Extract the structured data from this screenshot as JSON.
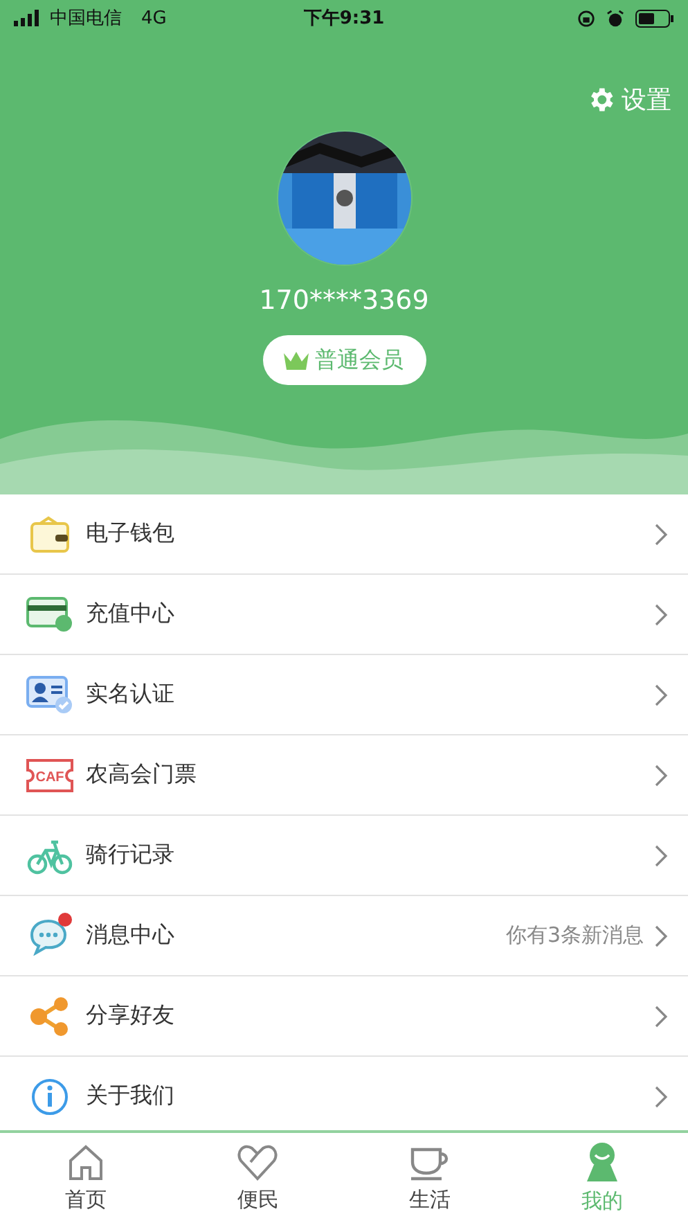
{
  "status_bar": {
    "carrier": "中国电信",
    "network": "4G",
    "time": "下午9:31"
  },
  "header": {
    "settings_label": "设置",
    "phone": "170****3369",
    "member_badge": "普通会员"
  },
  "menu": [
    {
      "label": "电子钱包"
    },
    {
      "label": "充值中心"
    },
    {
      "label": "实名认证"
    },
    {
      "label": "农高会门票",
      "icon_text": "CAF"
    },
    {
      "label": "骑行记录"
    },
    {
      "label": "消息中心",
      "note": "你有3条新消息",
      "unread": true
    },
    {
      "label": "分享好友"
    },
    {
      "label": "关于我们"
    }
  ],
  "tab_bar": [
    {
      "label": "首页",
      "selected": false
    },
    {
      "label": "便民",
      "selected": false
    },
    {
      "label": "生活",
      "selected": false
    },
    {
      "label": "我的",
      "selected": true
    }
  ]
}
